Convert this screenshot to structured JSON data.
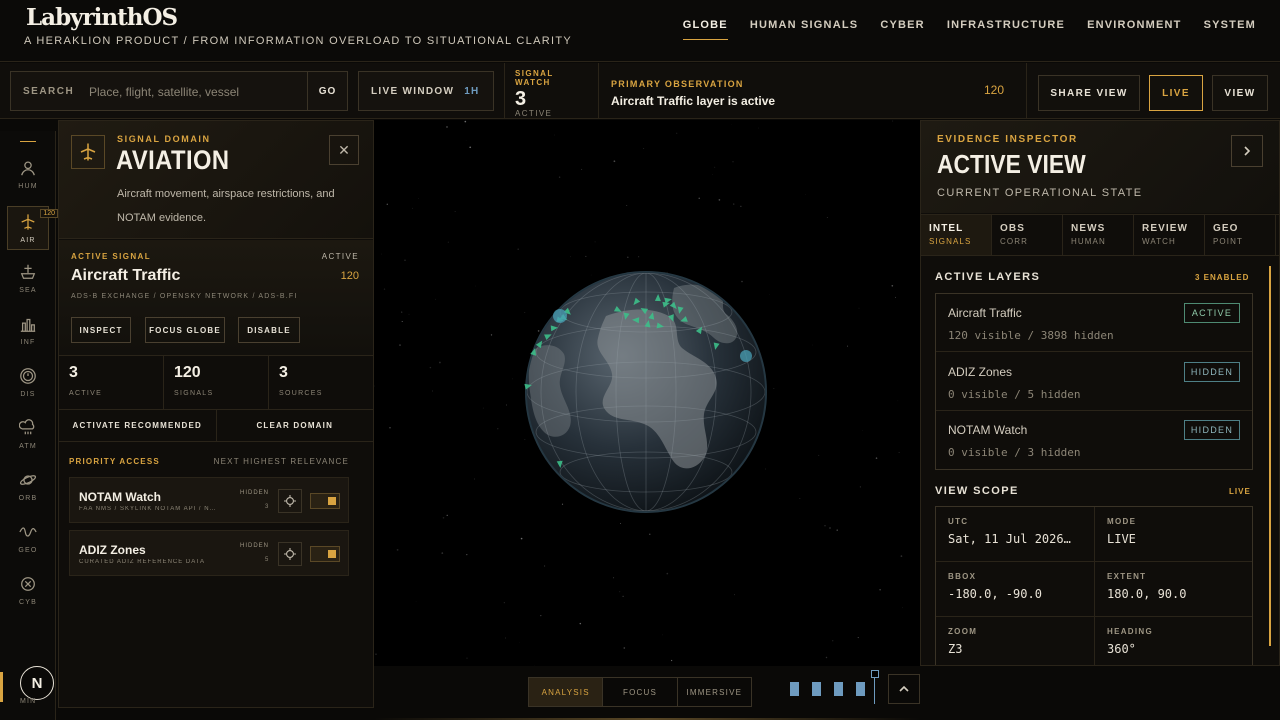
{
  "brand": {
    "name": "LabyrinthOS",
    "tagline": "A HERAKLION PRODUCT / FROM INFORMATION OVERLOAD TO SITUATIONAL CLARITY"
  },
  "nav": [
    {
      "label": "GLOBE",
      "active": true
    },
    {
      "label": "HUMAN SIGNALS"
    },
    {
      "label": "CYBER"
    },
    {
      "label": "INFRASTRUCTURE"
    },
    {
      "label": "ENVIRONMENT"
    },
    {
      "label": "SYSTEM"
    }
  ],
  "toolbar": {
    "search_label": "SEARCH",
    "search_placeholder": "Place, flight, satellite, vessel",
    "go_label": "GO",
    "live_window_label": "LIVE WINDOW",
    "live_window_value": "1H",
    "signal_watch": {
      "label": "SIGNAL WATCH",
      "value": "3",
      "sub": "ACTIVE"
    },
    "primary_observation": {
      "label": "PRIMARY OBSERVATION",
      "text": "Aircraft Traffic layer is active",
      "count": "120"
    },
    "share_label": "SHARE VIEW",
    "live_label": "LIVE",
    "view_label": "VIEW"
  },
  "rail": {
    "items": [
      {
        "label": "HUM",
        "icon": "person-icon"
      },
      {
        "label": "AIR",
        "icon": "plane-icon",
        "badge": "120",
        "active": true
      },
      {
        "label": "SEA",
        "icon": "ship-icon"
      },
      {
        "label": "INF",
        "icon": "factory-icon"
      },
      {
        "label": "DIS",
        "icon": "alert-circle-icon"
      },
      {
        "label": "ATM",
        "icon": "cloud-rain-icon"
      },
      {
        "label": "ORB",
        "icon": "planet-icon"
      },
      {
        "label": "GEO",
        "icon": "wave-icon"
      },
      {
        "label": "CYB",
        "icon": "cyber-icon"
      }
    ],
    "avatar": "N",
    "min_label": "MIN"
  },
  "domain": {
    "kicker": "SIGNAL DOMAIN",
    "title": "AVIATION",
    "description": "Aircraft movement, airspace restrictions, and NOTAM evidence.",
    "active_signal": {
      "label": "ACTIVE SIGNAL",
      "state": "ACTIVE",
      "title": "Aircraft Traffic",
      "count": "120",
      "sources": "ADS-B EXCHANGE / OPENSKY NETWORK / ADS-B.FI",
      "inspect": "INSPECT",
      "focus": "FOCUS GLOBE",
      "disable": "DISABLE"
    },
    "stats": [
      {
        "value": "3",
        "label": "ACTIVE"
      },
      {
        "value": "120",
        "label": "SIGNALS"
      },
      {
        "value": "3",
        "label": "SOURCES"
      }
    ],
    "activate_label": "ACTIVATE RECOMMENDED",
    "clear_label": "CLEAR DOMAIN",
    "priority": {
      "label": "PRIORITY ACCESS",
      "right_label": "NEXT HIGHEST RELEVANCE",
      "items": [
        {
          "title": "NOTAM Watch",
          "source": "FAA NMS / SKYLINK NOTAM API / N…",
          "state": "HIDDEN",
          "count": "3"
        },
        {
          "title": "ADIZ Zones",
          "source": "CURATED ADIZ REFERENCE DATA",
          "state": "HIDDEN",
          "count": "5"
        }
      ]
    }
  },
  "modes": [
    {
      "label": "ANALYSIS",
      "active": true
    },
    {
      "label": "FOCUS"
    },
    {
      "label": "IMMERSIVE"
    }
  ],
  "inspector": {
    "kicker": "EVIDENCE INSPECTOR",
    "title": "ACTIVE VIEW",
    "subtitle": "CURRENT OPERATIONAL STATE",
    "tabs": [
      {
        "label": "INTEL",
        "sub": "SIGNALS",
        "active": true
      },
      {
        "label": "OBS",
        "sub": "CORR"
      },
      {
        "label": "NEWS",
        "sub": "HUMAN"
      },
      {
        "label": "REVIEW",
        "sub": "WATCH"
      },
      {
        "label": "GEO",
        "sub": "POINT"
      }
    ],
    "layers_title": "ACTIVE LAYERS",
    "layers_count": "3 ENABLED",
    "layers": [
      {
        "name": "Aircraft Traffic",
        "visibility": "120 visible / 3898 hidden",
        "state": "ACTIVE"
      },
      {
        "name": "ADIZ Zones",
        "visibility": "0 visible / 5 hidden",
        "state": "HIDDEN"
      },
      {
        "name": "NOTAM Watch",
        "visibility": "0 visible / 3 hidden",
        "state": "HIDDEN"
      }
    ],
    "scope_title": "VIEW SCOPE",
    "scope_live": "LIVE",
    "scope": [
      {
        "key": "UTC",
        "value": "Sat, 11 Jul 2026…"
      },
      {
        "key": "MODE",
        "value": "LIVE"
      },
      {
        "key": "BBOX",
        "value": "-180.0, -90.0"
      },
      {
        "key": "EXTENT",
        "value": "180.0, 90.0"
      },
      {
        "key": "ZOOM",
        "value": "Z3"
      },
      {
        "key": "HEADING",
        "value": "360°"
      }
    ]
  },
  "colors": {
    "accent": "#d9a441",
    "teal": "#3dbf8a",
    "blue": "#6e9bbf",
    "background": "#0a0907"
  }
}
